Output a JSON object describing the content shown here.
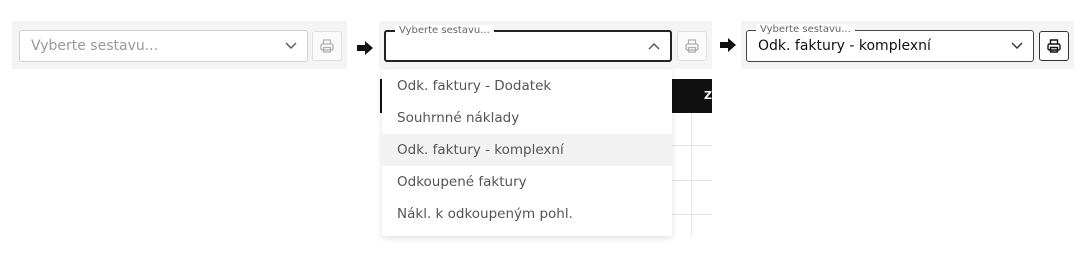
{
  "step1": {
    "placeholder": "Vyberte sestavu..."
  },
  "step2": {
    "label": "Vyberte sestavu...",
    "value": "",
    "options": [
      "Odk. faktury - Dodatek",
      "Souhrnné náklady",
      "Odk. faktury - komplexní",
      "Odkoupené faktury",
      "Nákl. k odkoupeným pohl."
    ],
    "highlighted_index": 2,
    "background_header_text": "Z"
  },
  "step3": {
    "label": "Vyberte sestavu...",
    "value": "Odk. faktury - komplexní"
  },
  "icons": {
    "print": "printer-icon",
    "chevron": "chevron-icon",
    "arrow": "right-arrow-icon"
  },
  "colors": {
    "panel_bg": "#f4f4f4",
    "border": "#cfcfcf",
    "active_border": "#222222",
    "header_bg": "#111111"
  }
}
